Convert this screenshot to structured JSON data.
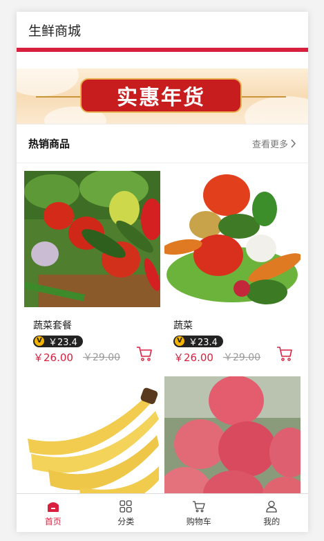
{
  "header": {
    "title": "生鲜商城"
  },
  "banner": {
    "text": "实惠年货"
  },
  "hot": {
    "title": "热销商品",
    "more_label": "查看更多"
  },
  "products": [
    {
      "name": "蔬菜套餐",
      "vip_badge": "V",
      "vip_price": "￥23.4",
      "price": "￥26.00",
      "old_price": "￥29.00",
      "image": "vegetable-assortment-photo"
    },
    {
      "name": "蔬菜",
      "vip_badge": "V",
      "vip_price": "￥23.4",
      "price": "￥26.00",
      "old_price": "￥29.00",
      "image": "vegetable-pile-photo"
    },
    {
      "name": "",
      "image": "banana-photo"
    },
    {
      "name": "",
      "image": "apple-photo"
    }
  ],
  "tabbar": {
    "items": [
      {
        "label": "首页",
        "icon": "home-icon",
        "active": true
      },
      {
        "label": "分类",
        "icon": "grid-icon",
        "active": false
      },
      {
        "label": "购物车",
        "icon": "cart-icon",
        "active": false
      },
      {
        "label": "我的",
        "icon": "user-icon",
        "active": false
      }
    ]
  },
  "colors": {
    "accent": "#d8203e",
    "badge_bg": "#222222",
    "vip_gold": "#f5b400"
  }
}
